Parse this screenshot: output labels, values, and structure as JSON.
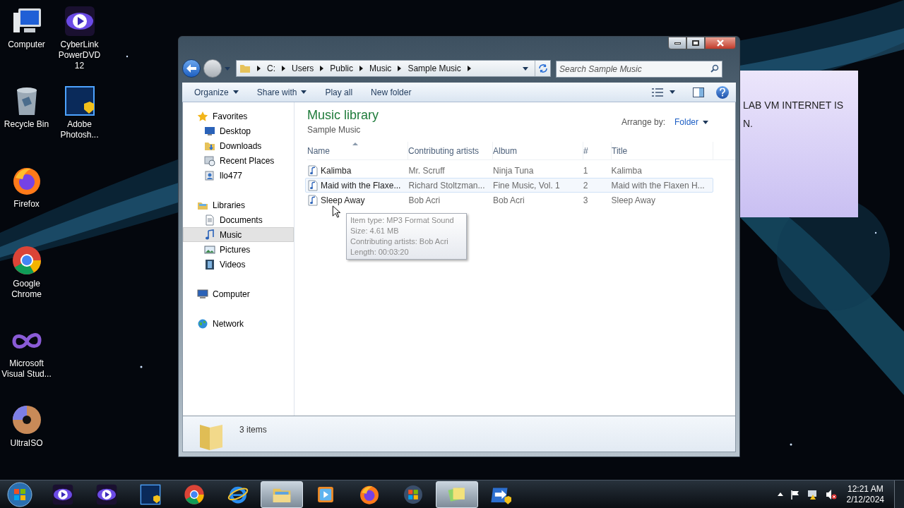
{
  "desktop_icons": [
    {
      "kind": "computer",
      "label": "Computer"
    },
    {
      "kind": "trash",
      "label": "Recycle Bin"
    },
    {
      "kind": "firefox",
      "label": "Firefox"
    },
    {
      "kind": "chrome",
      "label": "Google Chrome"
    },
    {
      "kind": "infinity",
      "label": "Microsoft Visual Stud..."
    },
    {
      "kind": "disc",
      "label": "UltraISO"
    },
    {
      "kind": "dvd",
      "label": "CyberLink PowerDVD 12"
    },
    {
      "kind": "photoshop",
      "label": "Adobe Photosh..."
    }
  ],
  "sticky_note": {
    "lines": [
      "LAB VM INTERNET IS",
      "N."
    ]
  },
  "window": {
    "address": [
      "C:",
      "Users",
      "Public",
      "Music",
      "Sample Music"
    ],
    "search": {
      "placeholder": "Search Sample Music"
    },
    "toolbar": [
      {
        "label": "Organize",
        "dropdown": true
      },
      {
        "label": "Share with",
        "dropdown": true
      },
      {
        "label": "Play all",
        "dropdown": false
      },
      {
        "label": "New folder",
        "dropdown": false
      }
    ],
    "nav": [
      {
        "kind": "star",
        "label": "Favorites",
        "selected": false,
        "children": [
          {
            "kind": "desktop",
            "label": "Desktop",
            "selected": false
          },
          {
            "kind": "download",
            "label": "Downloads",
            "selected": false
          },
          {
            "kind": "recent",
            "label": "Recent Places",
            "selected": false
          },
          {
            "kind": "user",
            "label": "llo477",
            "selected": false
          }
        ]
      },
      {
        "kind": "library",
        "label": "Libraries",
        "selected": false,
        "children": [
          {
            "kind": "document",
            "label": "Documents",
            "selected": false
          },
          {
            "kind": "music",
            "label": "Music",
            "selected": true
          },
          {
            "kind": "picture",
            "label": "Pictures",
            "selected": false
          },
          {
            "kind": "video",
            "label": "Videos",
            "selected": false
          }
        ]
      },
      {
        "kind": "computer",
        "label": "Computer",
        "selected": false
      },
      {
        "kind": "network",
        "label": "Network",
        "selected": false
      }
    ],
    "library": {
      "title": "Music library",
      "subtitle": "Sample Music",
      "arrange_label": "Arrange by:",
      "arrange_value": "Folder"
    },
    "table": {
      "columns": [
        {
          "label": "Name",
          "sorted": true
        },
        {
          "label": "Contributing artists",
          "sorted": false
        },
        {
          "label": "Album",
          "sorted": false
        },
        {
          "label": "#",
          "sorted": false
        },
        {
          "label": "Title",
          "sorted": false
        }
      ],
      "rows": [
        {
          "selected": false,
          "cells": [
            "Kalimba",
            "Mr. Scruff",
            "Ninja Tuna",
            "1",
            "Kalimba"
          ]
        },
        {
          "selected": true,
          "cells": [
            "Maid with the Flaxe...",
            "Richard Stoltzman...",
            "Fine Music, Vol. 1",
            "2",
            "Maid with the Flaxen H..."
          ]
        },
        {
          "selected": false,
          "cells": [
            "Sleep Away",
            "Bob Acri",
            "Bob Acri",
            "3",
            "Sleep Away"
          ]
        }
      ]
    },
    "tooltip": [
      "Item type: MP3 Format Sound",
      "Size: 4.61 MB",
      "Contributing artists: Bob Acri",
      "Length: 00:03:20"
    ],
    "status": "3 items"
  },
  "taskbar": {
    "items": [
      {
        "kind": "dvd",
        "active": false
      },
      {
        "kind": "dvd",
        "active": false
      },
      {
        "kind": "photoshop",
        "active": false
      },
      {
        "kind": "chrome",
        "active": false
      },
      {
        "kind": "ie",
        "active": false
      },
      {
        "kind": "explorer",
        "active": true
      },
      {
        "kind": "media",
        "active": false
      },
      {
        "kind": "firefox",
        "active": false
      },
      {
        "kind": "windows",
        "active": false
      },
      {
        "kind": "notes",
        "active": true
      },
      {
        "kind": "remote",
        "active": false
      }
    ],
    "time": "12:21 AM",
    "date": "2/12/2024"
  }
}
